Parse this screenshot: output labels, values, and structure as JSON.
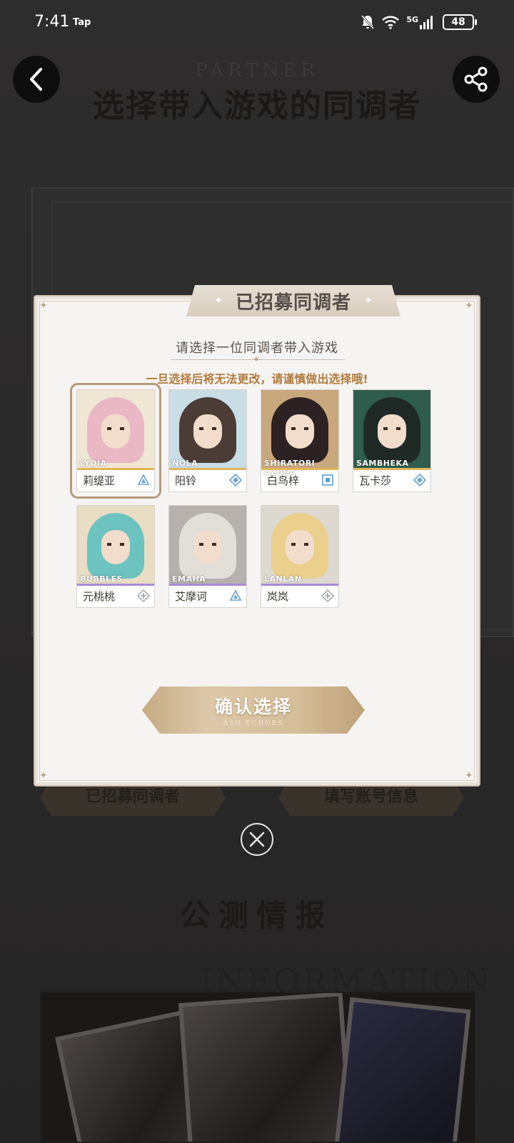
{
  "status_bar": {
    "time": "7:41",
    "app_indicator": "Tap",
    "network": "5G",
    "battery": "48"
  },
  "background_page": {
    "title": "选择带入游戏的同调者",
    "tab_left": "已招募同调者",
    "tab_right": "填写账号信息",
    "section_title": "公测情报",
    "section_title_en": "INFORMATION"
  },
  "modal": {
    "banner_title": "已招募同调者",
    "subtitle": "请选择一位同调者带入游戏",
    "warning": "一旦选择后将无法更改，请谨慎做出选择哦!",
    "confirm_label": "确认选择",
    "confirm_sub": "ASH ECHOES",
    "characters": [
      {
        "name": "莉缇亚",
        "en": "LYDIA",
        "selected": true,
        "class_icon": "triangle-class-icon",
        "rarity_color": "#e0b65a",
        "palette": {
          "bg": "#efe6d4",
          "hair": "#e9b8c4"
        }
      },
      {
        "name": "阳铃",
        "en": "NOLA",
        "selected": false,
        "class_icon": "diamond-class-icon",
        "rarity_color": "#e0b65a",
        "palette": {
          "bg": "#c8dde6",
          "hair": "#4b3c35"
        }
      },
      {
        "name": "白鸟梓",
        "en": "SHIRATORI AZUSA",
        "selected": false,
        "class_icon": "square-class-icon",
        "rarity_color": "#e0b65a",
        "palette": {
          "bg": "#c9a87e",
          "hair": "#2c2223"
        }
      },
      {
        "name": "瓦卡莎",
        "en": "SAMBHEKA",
        "selected": false,
        "class_icon": "diamond-class-icon",
        "rarity_color": "#e0b65a",
        "palette": {
          "bg": "#2f5d4d",
          "hair": "#1f2a27"
        }
      },
      {
        "name": "元桃桃",
        "en": "BUBBLES",
        "selected": false,
        "class_icon": "cross-class-icon",
        "rarity_color": "#a98ad6",
        "palette": {
          "bg": "#e9ddc3",
          "hair": "#6cc3c0"
        }
      },
      {
        "name": "艾摩诃",
        "en": "EMAHA",
        "selected": false,
        "class_icon": "triangle-class-icon",
        "rarity_color": "#a98ad6",
        "palette": {
          "bg": "#b7b1ae",
          "hair": "#e2ded8"
        }
      },
      {
        "name": "岚岚",
        "en": "LANLAN",
        "selected": false,
        "class_icon": "cross-class-icon",
        "rarity_color": "#a98ad6",
        "palette": {
          "bg": "#ddd8d0",
          "hair": "#ead08c"
        }
      }
    ]
  }
}
